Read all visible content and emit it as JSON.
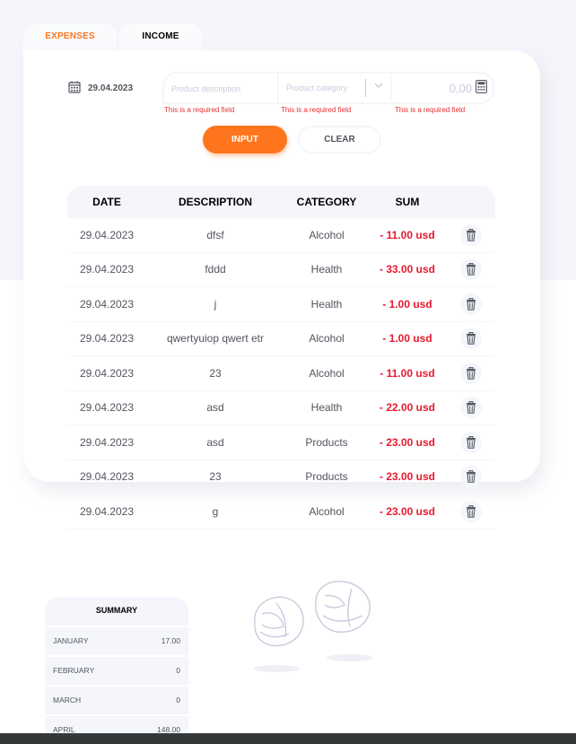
{
  "tabs": [
    {
      "label": "EXPENSES",
      "active": true
    },
    {
      "label": "INCOME",
      "active": false
    }
  ],
  "form": {
    "date": "29.04.2023",
    "description_placeholder": "Product description",
    "category_placeholder": "Product category",
    "sum_placeholder": "0,00",
    "error": "This is a required field",
    "input_label": "INPUT",
    "clear_label": "CLEAR"
  },
  "table": {
    "headers": [
      "DATE",
      "DESCRIPTION",
      "CATEGORY",
      "SUM"
    ],
    "rows": [
      {
        "date": "29.04.2023",
        "description": "dfsf",
        "category": "Alcohol",
        "sum": "- 11.00 usd"
      },
      {
        "date": "29.04.2023",
        "description": "fddd",
        "category": "Health",
        "sum": "- 33.00 usd"
      },
      {
        "date": "29.04.2023",
        "description": "j",
        "category": "Health",
        "sum": "- 1.00 usd"
      },
      {
        "date": "29.04.2023",
        "description": "qwertyuiop qwert etr",
        "category": "Alcohol",
        "sum": "- 1.00 usd"
      },
      {
        "date": "29.04.2023",
        "description": "23",
        "category": "Alcohol",
        "sum": "- 11.00 usd"
      },
      {
        "date": "29.04.2023",
        "description": "asd",
        "category": "Health",
        "sum": "- 22.00 usd"
      },
      {
        "date": "29.04.2023",
        "description": "asd",
        "category": "Products",
        "sum": "- 23.00 usd"
      },
      {
        "date": "29.04.2023",
        "description": "23",
        "category": "Products",
        "sum": "- 23.00 usd"
      },
      {
        "date": "29.04.2023",
        "description": "g",
        "category": "Alcohol",
        "sum": "- 23.00 usd"
      }
    ]
  },
  "summary": {
    "title": "SUMMARY",
    "rows": [
      {
        "month": "JANUARY",
        "value": "17.00"
      },
      {
        "month": "FEBRUARY",
        "value": "0"
      },
      {
        "month": "MARCH",
        "value": "0"
      },
      {
        "month": "APRIL",
        "value": "148.00"
      }
    ]
  },
  "colors": {
    "accent": "#ff751d",
    "negative": "#e7192e",
    "error": "#e53030",
    "panel_bg": "#f5f6fb"
  }
}
